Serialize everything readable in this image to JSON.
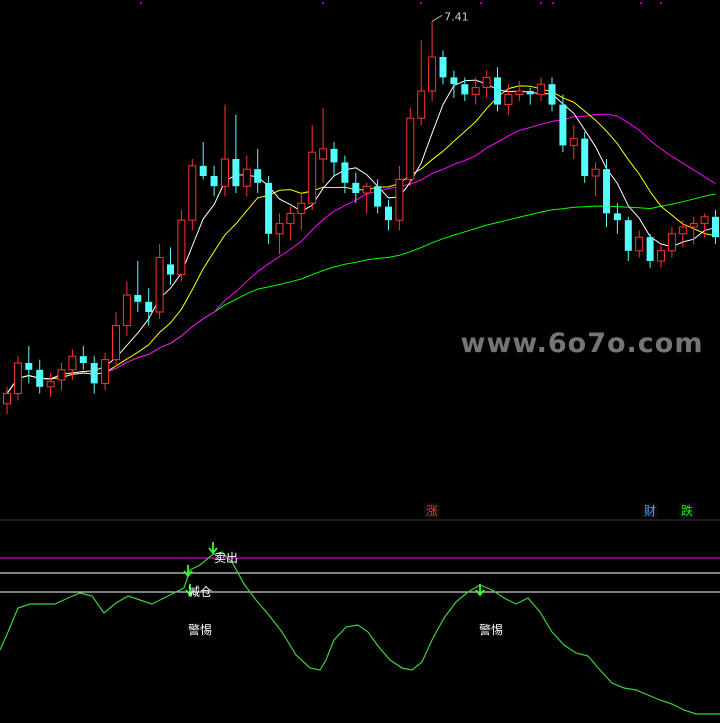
{
  "watermark": "www.6o7o.com",
  "chart_data": [
    {
      "type": "candlestick",
      "panel": "price",
      "peak_label": "7.41",
      "colors": {
        "up": "#ff3232",
        "down": "#54fcfc",
        "ma5": "#ffffff",
        "ma10": "#ffff00",
        "ma20": "#ff00ff",
        "ma60": "#00ff00"
      },
      "candles": [
        [
          5.16,
          5.26,
          5.1,
          5.22
        ],
        [
          5.22,
          5.44,
          5.18,
          5.4
        ],
        [
          5.4,
          5.5,
          5.28,
          5.36
        ],
        [
          5.36,
          5.42,
          5.22,
          5.26
        ],
        [
          5.26,
          5.34,
          5.2,
          5.29
        ],
        [
          5.3,
          5.4,
          5.24,
          5.36
        ],
        [
          5.36,
          5.48,
          5.3,
          5.44
        ],
        [
          5.44,
          5.5,
          5.36,
          5.4
        ],
        [
          5.4,
          5.44,
          5.22,
          5.28
        ],
        [
          5.28,
          5.46,
          5.24,
          5.42
        ],
        [
          5.42,
          5.7,
          5.38,
          5.62
        ],
        [
          5.62,
          5.88,
          5.56,
          5.8
        ],
        [
          5.8,
          6.0,
          5.7,
          5.76
        ],
        [
          5.76,
          5.84,
          5.62,
          5.7
        ],
        [
          5.7,
          6.1,
          5.66,
          6.02
        ],
        [
          5.98,
          6.08,
          5.86,
          5.92
        ],
        [
          5.92,
          6.3,
          5.88,
          6.24
        ],
        [
          6.24,
          6.6,
          6.18,
          6.56
        ],
        [
          6.56,
          6.7,
          6.48,
          6.5
        ],
        [
          6.5,
          6.56,
          6.38,
          6.44
        ],
        [
          6.44,
          6.92,
          6.38,
          6.6
        ],
        [
          6.6,
          6.86,
          6.4,
          6.44
        ],
        [
          6.44,
          6.62,
          6.38,
          6.54
        ],
        [
          6.54,
          6.66,
          6.4,
          6.46
        ],
        [
          6.46,
          6.5,
          6.1,
          6.16
        ],
        [
          6.16,
          6.28,
          6.04,
          6.22
        ],
        [
          6.22,
          6.32,
          6.12,
          6.28
        ],
        [
          6.28,
          6.4,
          6.18,
          6.34
        ],
        [
          6.34,
          6.8,
          6.3,
          6.64
        ],
        [
          6.6,
          6.9,
          6.46,
          6.66
        ],
        [
          6.66,
          6.7,
          6.5,
          6.58
        ],
        [
          6.58,
          6.62,
          6.4,
          6.46
        ],
        [
          6.46,
          6.52,
          6.34,
          6.4
        ],
        [
          6.4,
          6.46,
          6.28,
          6.44
        ],
        [
          6.44,
          6.48,
          6.28,
          6.32
        ],
        [
          6.32,
          6.36,
          6.18,
          6.24
        ],
        [
          6.24,
          6.56,
          6.18,
          6.48
        ],
        [
          6.48,
          6.9,
          6.44,
          6.84
        ],
        [
          6.84,
          7.3,
          6.8,
          7.0
        ],
        [
          7.0,
          7.41,
          6.94,
          7.2
        ],
        [
          7.2,
          7.24,
          7.04,
          7.08
        ],
        [
          7.08,
          7.12,
          6.96,
          7.04
        ],
        [
          7.04,
          7.08,
          6.94,
          6.98
        ],
        [
          6.98,
          7.08,
          6.92,
          7.02
        ],
        [
          7.02,
          7.12,
          6.96,
          7.08
        ],
        [
          7.08,
          7.14,
          6.88,
          6.92
        ],
        [
          6.92,
          7.04,
          6.86,
          6.98
        ],
        [
          6.98,
          7.06,
          6.94,
          7.0
        ],
        [
          7.0,
          7.02,
          6.92,
          6.98
        ],
        [
          6.98,
          7.08,
          6.94,
          7.04
        ],
        [
          7.04,
          7.08,
          6.88,
          6.92
        ],
        [
          6.92,
          6.98,
          6.64,
          6.68
        ],
        [
          6.68,
          6.8,
          6.6,
          6.72
        ],
        [
          6.72,
          6.76,
          6.46,
          6.5
        ],
        [
          6.5,
          6.58,
          6.38,
          6.54
        ],
        [
          6.54,
          6.6,
          6.2,
          6.28
        ],
        [
          6.28,
          6.34,
          6.16,
          6.24
        ],
        [
          6.24,
          6.26,
          6.0,
          6.06
        ],
        [
          6.06,
          6.18,
          6.02,
          6.14
        ],
        [
          6.14,
          6.16,
          5.96,
          6.0
        ],
        [
          6.0,
          6.1,
          5.96,
          6.06
        ],
        [
          6.06,
          6.2,
          6.02,
          6.16
        ],
        [
          6.16,
          6.24,
          6.08,
          6.2
        ],
        [
          6.2,
          6.26,
          6.1,
          6.22
        ],
        [
          6.22,
          6.28,
          6.14,
          6.26
        ],
        [
          6.26,
          6.3,
          6.1,
          6.14
        ]
      ]
    },
    {
      "type": "line",
      "panel": "indicator",
      "line_color": "#3cd23c",
      "ref_line_color": "#ff00ff",
      "signals": [
        {
          "label": "涨",
          "color": "#ff3232"
        },
        {
          "label": "财",
          "color": "#4ea0ff"
        },
        {
          "label": "跌",
          "color": "#00ff00"
        }
      ],
      "labels": {
        "sell": "卖出",
        "reduce": "减仓",
        "warn1": "警惕",
        "warn2": "警惕"
      }
    }
  ]
}
